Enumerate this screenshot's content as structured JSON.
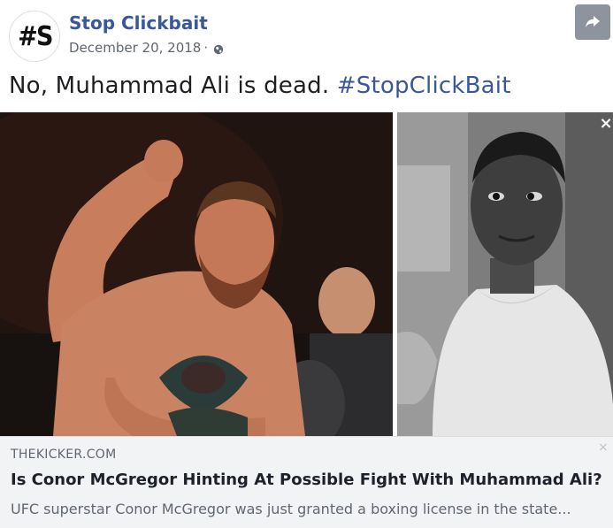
{
  "post": {
    "avatar_text": "#S",
    "page_name": "Stop Clickbait",
    "date": "December 20, 2018",
    "separator": "·",
    "privacy_icon": "globe-icon",
    "share_icon": "share-arrow-icon",
    "text": "No, Muhammad Ali is dead. ",
    "hashtag": "#StopClickBait"
  },
  "media": {
    "close_label": "×",
    "left_photo": "conor-mcgregor-photo",
    "right_photo": "muhammad-ali-photo"
  },
  "link_preview": {
    "domain": "THEKICKER.COM",
    "title": "Is Conor McGregor Hinting At Possible Fight With Muhammad Ali?",
    "description": "UFC superstar Conor McGregor was just granted a boxing license in the state...",
    "close_label": "×"
  },
  "colors": {
    "link_blue": "#385898",
    "meta_gray": "#606770",
    "preview_bg": "#f2f3f5",
    "share_bg": "#8d949e"
  }
}
